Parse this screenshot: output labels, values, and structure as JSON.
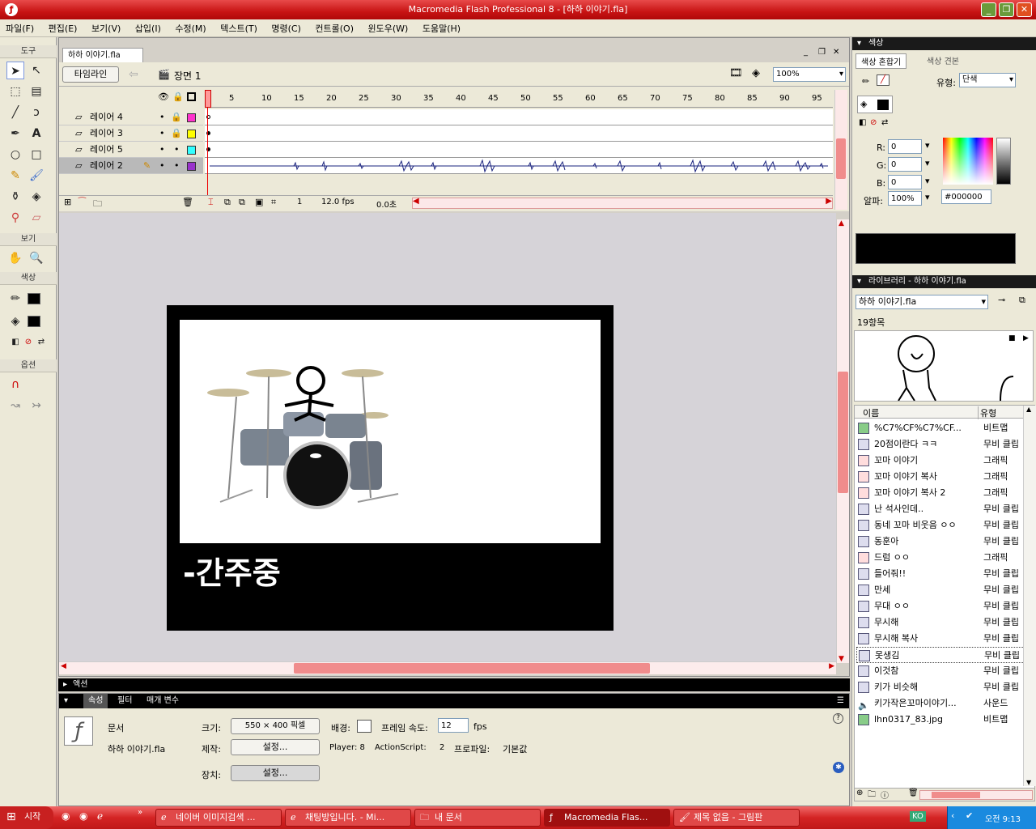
{
  "window": {
    "title": "Macromedia Flash Professional 8 - [하하 이야기.fla]"
  },
  "menu": [
    "파일(F)",
    "편집(E)",
    "보기(V)",
    "삽입(I)",
    "수정(M)",
    "텍스트(T)",
    "명령(C)",
    "컨트롤(O)",
    "윈도우(W)",
    "도움말(H)"
  ],
  "tools": {
    "title": "도구",
    "view": "보기",
    "color": "색상",
    "options": "옵션"
  },
  "doc": {
    "tab": "하하 이야기.fla",
    "timeline_btn": "타임라인",
    "scene": "장면 1",
    "zoom": "100%"
  },
  "timeline": {
    "ruler": [
      "5",
      "10",
      "15",
      "20",
      "25",
      "30",
      "35",
      "40",
      "45",
      "50",
      "55",
      "60",
      "65",
      "70",
      "75",
      "80",
      "85",
      "90",
      "95"
    ],
    "layers": [
      {
        "name": "레이어 4",
        "color": "#ff33cc"
      },
      {
        "name": "레이어 3",
        "color": "#ffff00"
      },
      {
        "name": "레이어 5",
        "color": "#33ffff"
      },
      {
        "name": "레이어 2",
        "color": "#9933cc"
      }
    ],
    "frame": "1",
    "fps": "12.0 fps",
    "time": "0.0초"
  },
  "stage": {
    "caption": "-간주중"
  },
  "color_panel": {
    "title": "색상",
    "tab1": "색상 혼합기",
    "tab2": "색상 견본",
    "type_label": "유형:",
    "type_value": "단색",
    "r_label": "R:",
    "r": "0",
    "g_label": "G:",
    "g": "0",
    "b_label": "B:",
    "b": "0",
    "alpha_label": "알파:",
    "alpha": "100%",
    "hex": "#000000"
  },
  "library": {
    "title": "라이브러리 - 하하 이야기.fla",
    "file": "하하 이야기.fla",
    "count": "19항목",
    "col_name": "이름",
    "col_type": "유형",
    "items": [
      {
        "name": "%C7%CF%C7%CF...",
        "type": "비트맵"
      },
      {
        "name": "20점이란다 ㅋㅋ",
        "type": "무비 클립"
      },
      {
        "name": "꼬마 이야기",
        "type": "그래픽"
      },
      {
        "name": "꼬마 이야기 복사",
        "type": "그래픽"
      },
      {
        "name": "꼬마 이야기 복사 2",
        "type": "그래픽"
      },
      {
        "name": "난 석사인데..",
        "type": "무비 클립"
      },
      {
        "name": "동네 꼬마 비웃음 ㅇㅇ",
        "type": "무비 클립"
      },
      {
        "name": "동훈아",
        "type": "무비 클립"
      },
      {
        "name": "드럼 ㅇㅇ",
        "type": "그래픽"
      },
      {
        "name": "들어줘!!",
        "type": "무비 클립"
      },
      {
        "name": "만세",
        "type": "무비 클립"
      },
      {
        "name": "무대 ㅇㅇ",
        "type": "무비 클립"
      },
      {
        "name": "무시해",
        "type": "무비 클립"
      },
      {
        "name": "무시해 복사",
        "type": "무비 클립"
      },
      {
        "name": "못생김",
        "type": "무비 클립"
      },
      {
        "name": "이것참",
        "type": "무비 클립"
      },
      {
        "name": "키가 비슷해",
        "type": "무비 클립"
      },
      {
        "name": "키가작은꼬마이야기...",
        "type": "사운드"
      },
      {
        "name": "lhn0317_83.jpg",
        "type": "비트맵"
      }
    ]
  },
  "actions": {
    "title": "액션"
  },
  "props": {
    "tab1": "속성",
    "tab2": "필터",
    "tab3": "매개 변수",
    "doc_label": "문서",
    "doc_name": "하하 이야기.fla",
    "size_label": "크기:",
    "size_value": "550 × 400 픽셀",
    "bg_label": "배경:",
    "fps_label": "프레임 속도:",
    "fps_value": "12",
    "fps_unit": "fps",
    "publish_label": "제작:",
    "settings_btn": "설정...",
    "player": "Player: 8",
    "as_label": "ActionScript:",
    "as_value": "2",
    "profile_label": "프로파일:",
    "profile_value": "기본값",
    "device_label": "장치:",
    "device_btn": "설정..."
  },
  "taskbar": {
    "start": "시작",
    "tasks": [
      "네이버 이미지검색 ...",
      "채팅방입니다. - Mi...",
      "내 문서",
      "Macromedia Flas...",
      "제목 없음 - 그림판"
    ],
    "ime": "KO",
    "clock": "오전 9:13"
  }
}
